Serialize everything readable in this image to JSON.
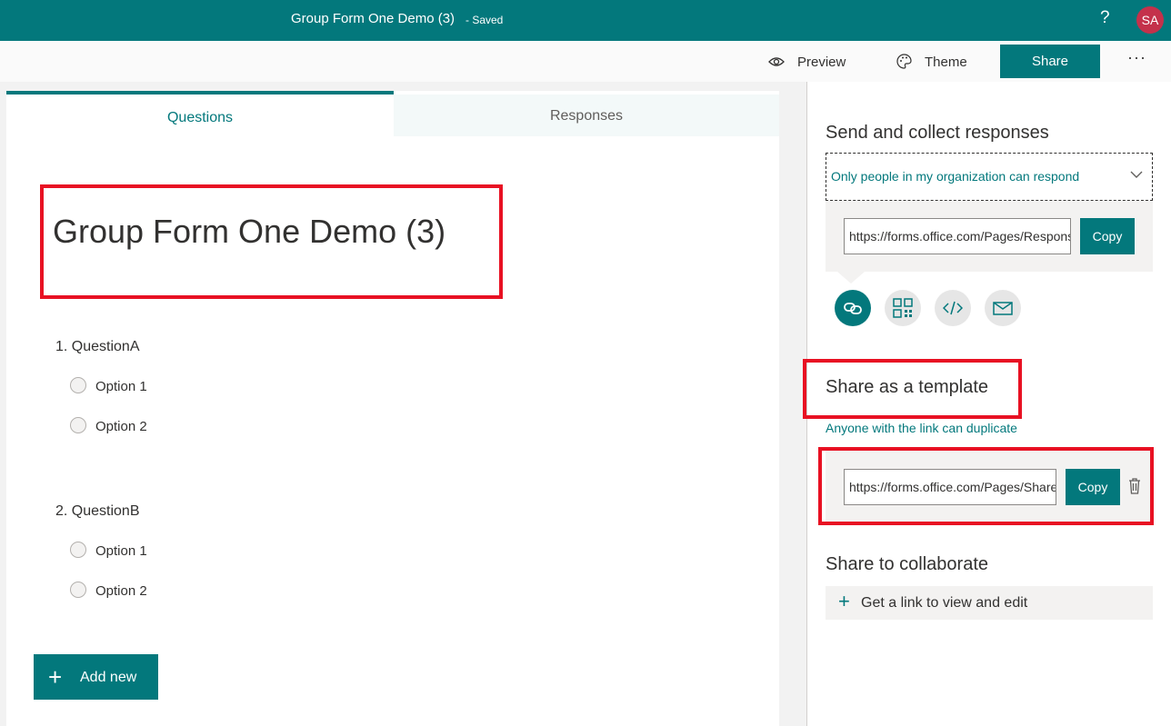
{
  "header": {
    "form_title": "Group Form One Demo (3)",
    "saved_status": "- Saved",
    "help": "?",
    "avatar_initials": "SA"
  },
  "commands": {
    "preview": "Preview",
    "theme": "Theme",
    "share": "Share",
    "more": "···"
  },
  "tabs": {
    "questions": "Questions",
    "responses": "Responses"
  },
  "form": {
    "title": "Group Form One Demo (3)",
    "questions": [
      {
        "label": "1. QuestionA",
        "options": [
          "Option 1",
          "Option 2"
        ]
      },
      {
        "label": "2. QuestionB",
        "options": [
          "Option 1",
          "Option 2"
        ]
      }
    ],
    "add_new": "Add new"
  },
  "share_panel": {
    "send_title": "Send and collect responses",
    "permission": "Only people in my organization can respond",
    "response_url": "https://forms.office.com/Pages/ResponsePage.aspx",
    "copy_label": "Copy",
    "template_title": "Share as a template",
    "template_sub": "Anyone with the link can duplicate",
    "template_url": "https://forms.office.com/Pages/ShareFormPage.aspx",
    "collab_title": "Share to collaborate",
    "collab_link": "Get a link to view and edit"
  },
  "icons": [
    "eye-icon",
    "palette-icon",
    "link-icon",
    "qr-code-icon",
    "embed-code-icon",
    "email-icon",
    "trash-icon",
    "chevron-down-icon",
    "plus-icon"
  ],
  "colors": {
    "accent": "#03787c",
    "highlight_red": "#e81123",
    "avatar": "#c4314b"
  }
}
